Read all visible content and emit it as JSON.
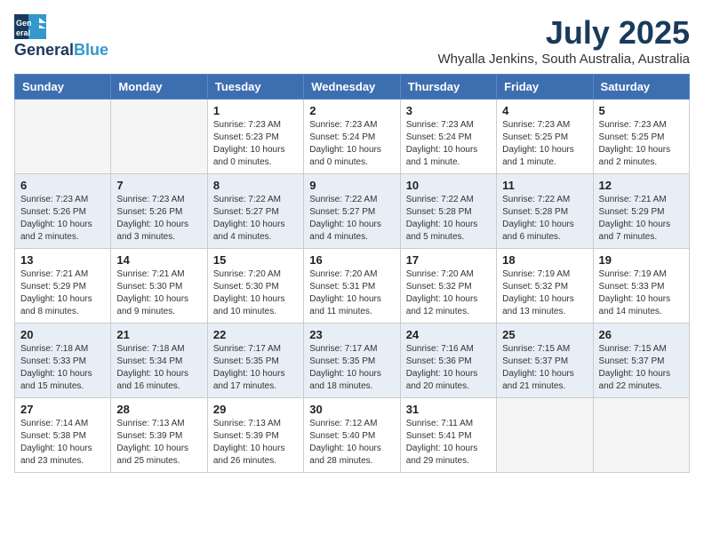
{
  "header": {
    "logo_general": "General",
    "logo_blue": "Blue",
    "month": "July 2025",
    "location": "Whyalla Jenkins, South Australia, Australia"
  },
  "days_of_week": [
    "Sunday",
    "Monday",
    "Tuesday",
    "Wednesday",
    "Thursday",
    "Friday",
    "Saturday"
  ],
  "weeks": [
    [
      {
        "day": "",
        "info": ""
      },
      {
        "day": "",
        "info": ""
      },
      {
        "day": "1",
        "info": "Sunrise: 7:23 AM\nSunset: 5:23 PM\nDaylight: 10 hours\nand 0 minutes."
      },
      {
        "day": "2",
        "info": "Sunrise: 7:23 AM\nSunset: 5:24 PM\nDaylight: 10 hours\nand 0 minutes."
      },
      {
        "day": "3",
        "info": "Sunrise: 7:23 AM\nSunset: 5:24 PM\nDaylight: 10 hours\nand 1 minute."
      },
      {
        "day": "4",
        "info": "Sunrise: 7:23 AM\nSunset: 5:25 PM\nDaylight: 10 hours\nand 1 minute."
      },
      {
        "day": "5",
        "info": "Sunrise: 7:23 AM\nSunset: 5:25 PM\nDaylight: 10 hours\nand 2 minutes."
      }
    ],
    [
      {
        "day": "6",
        "info": "Sunrise: 7:23 AM\nSunset: 5:26 PM\nDaylight: 10 hours\nand 2 minutes."
      },
      {
        "day": "7",
        "info": "Sunrise: 7:23 AM\nSunset: 5:26 PM\nDaylight: 10 hours\nand 3 minutes."
      },
      {
        "day": "8",
        "info": "Sunrise: 7:22 AM\nSunset: 5:27 PM\nDaylight: 10 hours\nand 4 minutes."
      },
      {
        "day": "9",
        "info": "Sunrise: 7:22 AM\nSunset: 5:27 PM\nDaylight: 10 hours\nand 4 minutes."
      },
      {
        "day": "10",
        "info": "Sunrise: 7:22 AM\nSunset: 5:28 PM\nDaylight: 10 hours\nand 5 minutes."
      },
      {
        "day": "11",
        "info": "Sunrise: 7:22 AM\nSunset: 5:28 PM\nDaylight: 10 hours\nand 6 minutes."
      },
      {
        "day": "12",
        "info": "Sunrise: 7:21 AM\nSunset: 5:29 PM\nDaylight: 10 hours\nand 7 minutes."
      }
    ],
    [
      {
        "day": "13",
        "info": "Sunrise: 7:21 AM\nSunset: 5:29 PM\nDaylight: 10 hours\nand 8 minutes."
      },
      {
        "day": "14",
        "info": "Sunrise: 7:21 AM\nSunset: 5:30 PM\nDaylight: 10 hours\nand 9 minutes."
      },
      {
        "day": "15",
        "info": "Sunrise: 7:20 AM\nSunset: 5:30 PM\nDaylight: 10 hours\nand 10 minutes."
      },
      {
        "day": "16",
        "info": "Sunrise: 7:20 AM\nSunset: 5:31 PM\nDaylight: 10 hours\nand 11 minutes."
      },
      {
        "day": "17",
        "info": "Sunrise: 7:20 AM\nSunset: 5:32 PM\nDaylight: 10 hours\nand 12 minutes."
      },
      {
        "day": "18",
        "info": "Sunrise: 7:19 AM\nSunset: 5:32 PM\nDaylight: 10 hours\nand 13 minutes."
      },
      {
        "day": "19",
        "info": "Sunrise: 7:19 AM\nSunset: 5:33 PM\nDaylight: 10 hours\nand 14 minutes."
      }
    ],
    [
      {
        "day": "20",
        "info": "Sunrise: 7:18 AM\nSunset: 5:33 PM\nDaylight: 10 hours\nand 15 minutes."
      },
      {
        "day": "21",
        "info": "Sunrise: 7:18 AM\nSunset: 5:34 PM\nDaylight: 10 hours\nand 16 minutes."
      },
      {
        "day": "22",
        "info": "Sunrise: 7:17 AM\nSunset: 5:35 PM\nDaylight: 10 hours\nand 17 minutes."
      },
      {
        "day": "23",
        "info": "Sunrise: 7:17 AM\nSunset: 5:35 PM\nDaylight: 10 hours\nand 18 minutes."
      },
      {
        "day": "24",
        "info": "Sunrise: 7:16 AM\nSunset: 5:36 PM\nDaylight: 10 hours\nand 20 minutes."
      },
      {
        "day": "25",
        "info": "Sunrise: 7:15 AM\nSunset: 5:37 PM\nDaylight: 10 hours\nand 21 minutes."
      },
      {
        "day": "26",
        "info": "Sunrise: 7:15 AM\nSunset: 5:37 PM\nDaylight: 10 hours\nand 22 minutes."
      }
    ],
    [
      {
        "day": "27",
        "info": "Sunrise: 7:14 AM\nSunset: 5:38 PM\nDaylight: 10 hours\nand 23 minutes."
      },
      {
        "day": "28",
        "info": "Sunrise: 7:13 AM\nSunset: 5:39 PM\nDaylight: 10 hours\nand 25 minutes."
      },
      {
        "day": "29",
        "info": "Sunrise: 7:13 AM\nSunset: 5:39 PM\nDaylight: 10 hours\nand 26 minutes."
      },
      {
        "day": "30",
        "info": "Sunrise: 7:12 AM\nSunset: 5:40 PM\nDaylight: 10 hours\nand 28 minutes."
      },
      {
        "day": "31",
        "info": "Sunrise: 7:11 AM\nSunset: 5:41 PM\nDaylight: 10 hours\nand 29 minutes."
      },
      {
        "day": "",
        "info": ""
      },
      {
        "day": "",
        "info": ""
      }
    ]
  ]
}
